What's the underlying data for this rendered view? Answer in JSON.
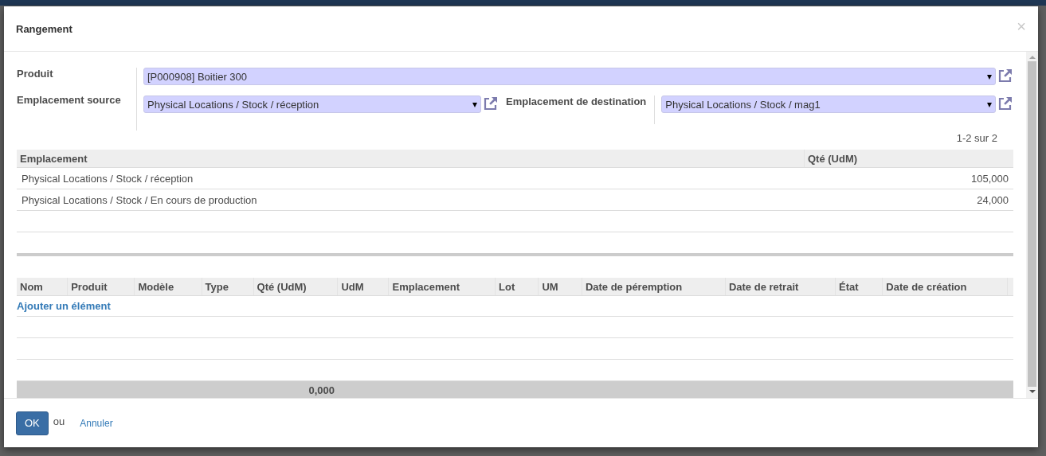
{
  "dialog": {
    "title": "Rangement",
    "close": "×"
  },
  "fields": [
    {
      "label": "Produit",
      "value": "[P000908] Boitier 300",
      "caret": "▾"
    },
    {
      "label": "Emplacement source",
      "value": "Physical Locations / Stock / réception",
      "caret": "▾"
    },
    {
      "label": "Emplacement de destination",
      "value": "Physical Locations / Stock / mag1",
      "caret": "▾"
    }
  ],
  "pager": "1-2 sur 2",
  "quants": {
    "columns": [
      "Emplacement",
      "Qté (UdM)"
    ],
    "rows": [
      [
        "Physical Locations / Stock / réception",
        "105,000"
      ],
      [
        "Physical Locations / Stock / En cours de production",
        "24,000"
      ]
    ]
  },
  "lines": {
    "columns": [
      "Nom",
      "Produit",
      "Modèle",
      "Type",
      "Qté (UdM)",
      "UdM",
      "Emplacement",
      "Lot",
      "UM",
      "Date de péremption",
      "Date de retrait",
      "État",
      "Date de création"
    ],
    "add_link": "Ajouter un élément",
    "total": "0,000"
  },
  "footer": {
    "ok": "OK",
    "or": "ou",
    "cancel": "Annuler"
  }
}
